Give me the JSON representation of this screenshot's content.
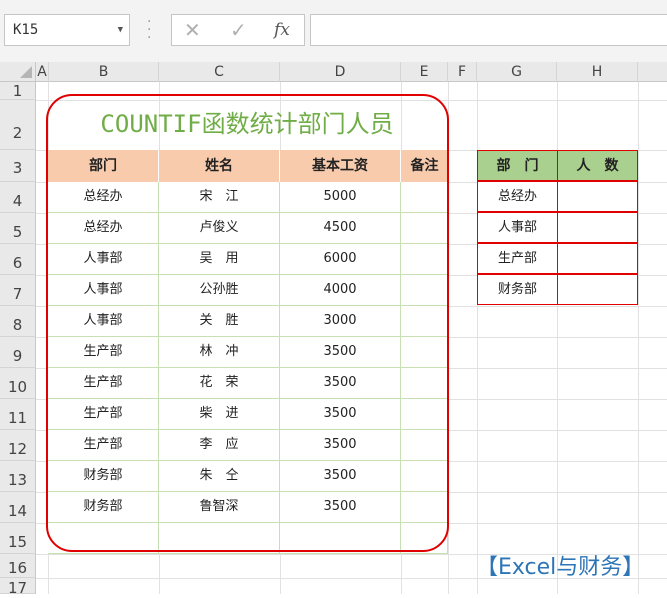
{
  "formula_bar": {
    "name_box": "K15",
    "cancel_symbol": "✕",
    "enter_symbol": "✓",
    "fx_label": "fx",
    "formula": ""
  },
  "columns": [
    "A",
    "B",
    "C",
    "D",
    "E",
    "F",
    "G",
    "H"
  ],
  "rows": [
    "1",
    "2",
    "3",
    "4",
    "5",
    "6",
    "7",
    "8",
    "9",
    "10",
    "11",
    "12",
    "13",
    "14",
    "15",
    "16",
    "17"
  ],
  "title": "COUNTIF函数统计部门人员",
  "main_table": {
    "headers": [
      "部门",
      "姓名",
      "基本工资",
      "备注"
    ],
    "rows": [
      [
        "总经办",
        "宋　江",
        "5000",
        ""
      ],
      [
        "总经办",
        "卢俊义",
        "4500",
        ""
      ],
      [
        "人事部",
        "吴　用",
        "6000",
        ""
      ],
      [
        "人事部",
        "公孙胜",
        "4000",
        ""
      ],
      [
        "人事部",
        "关　胜",
        "3000",
        ""
      ],
      [
        "生产部",
        "林　冲",
        "3500",
        ""
      ],
      [
        "生产部",
        "花　荣",
        "3500",
        ""
      ],
      [
        "生产部",
        "柴　进",
        "3500",
        ""
      ],
      [
        "生产部",
        "李　应",
        "3500",
        ""
      ],
      [
        "财务部",
        "朱　仝",
        "3500",
        ""
      ],
      [
        "财务部",
        "鲁智深",
        "3500",
        ""
      ],
      [
        "",
        "",
        "",
        ""
      ]
    ]
  },
  "summary_table": {
    "headers": [
      "部　门",
      "人　数"
    ],
    "rows": [
      [
        "总经办",
        ""
      ],
      [
        "人事部",
        ""
      ],
      [
        "生产部",
        ""
      ],
      [
        "财务部",
        ""
      ]
    ]
  },
  "brand": "【Excel与财务】",
  "colors": {
    "title": "#70ad47",
    "main_header_fill": "#f8cbad",
    "summary_header_fill": "#a9d08e",
    "frame": "#e00000",
    "brand": "#2e75b6"
  }
}
